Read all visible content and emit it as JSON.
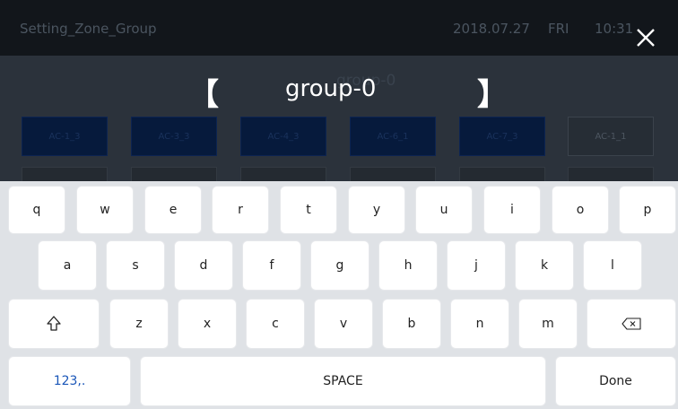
{
  "app": {
    "title": "Setting_Zone_Group",
    "date": "2018.07.27",
    "day": "FRI",
    "time": "10:31",
    "ghost_group": "group-0",
    "zones": [
      "AC-1_3",
      "AC-3_3",
      "AC-4_3",
      "AC-6_1",
      "AC-7_3",
      "AC-1_1"
    ]
  },
  "input": {
    "left_bracket": "【",
    "value": "group-0",
    "right_bracket": "】"
  },
  "keyboard": {
    "row1": [
      "q",
      "w",
      "e",
      "r",
      "t",
      "y",
      "u",
      "i",
      "o",
      "p"
    ],
    "row2": [
      "a",
      "s",
      "d",
      "f",
      "g",
      "h",
      "j",
      "k",
      "l"
    ],
    "row3": [
      "z",
      "x",
      "c",
      "v",
      "b",
      "n",
      "m"
    ],
    "numbers_label": "123,.",
    "space_label": "SPACE",
    "done_label": "Done",
    "shift_icon": "shift-arrow-icon",
    "backspace_icon": "backspace-icon"
  },
  "colors": {
    "header_bg": "#12161b",
    "keyboard_bg": "#dfe2e6",
    "accent_blue": "#1a56b8",
    "zone_tile_bg": "#061a3c"
  }
}
